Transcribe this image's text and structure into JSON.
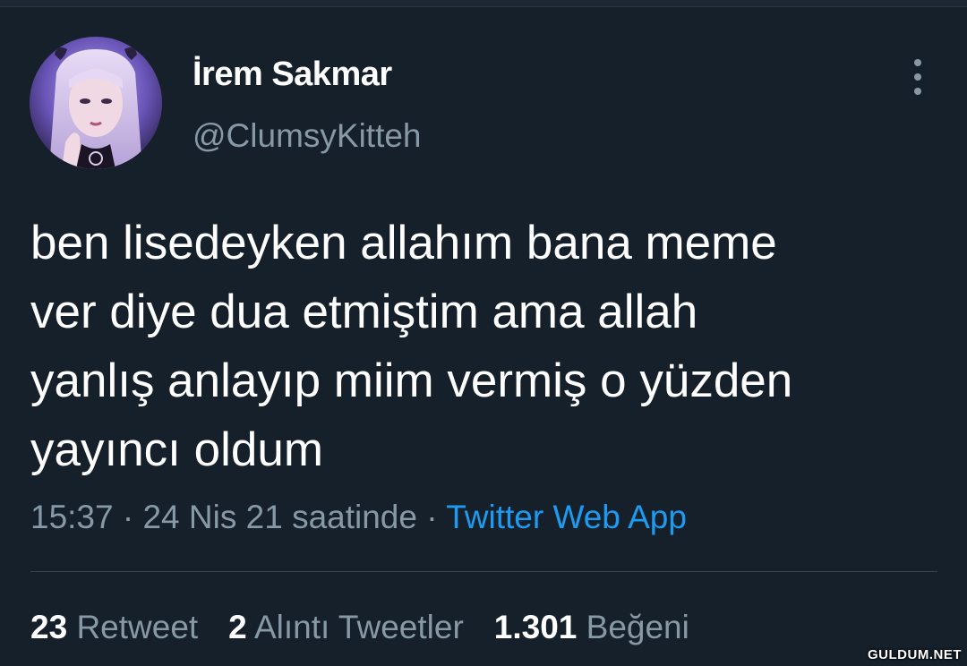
{
  "tweet": {
    "author": {
      "display_name": "İrem Sakmar",
      "handle": "@ClumsyKitteh",
      "avatar_icon": "profile-photo"
    },
    "text": "ben lisedeyken allahım bana meme\nver diye dua etmiştim ama allah\nyanlış anlayıp miim vermiş o yüzden\nyayıncı oldum",
    "meta": {
      "time": "15:37",
      "separator": "·",
      "date": "24 Nis 21 saatinde",
      "source": "Twitter Web App"
    },
    "stats": {
      "retweets": {
        "count": "23",
        "label": "Retweet"
      },
      "quotes": {
        "count": "2",
        "label": "Alıntı Tweetler"
      },
      "likes": {
        "count": "1.301",
        "label": "Beğeni"
      }
    },
    "more_icon": "more-vertical-icon"
  },
  "watermark": "GULDUM.NET",
  "colors": {
    "background": "#15202b",
    "secondary_text": "#8899a6",
    "link": "#1d9bf0",
    "divider": "#38444d"
  }
}
